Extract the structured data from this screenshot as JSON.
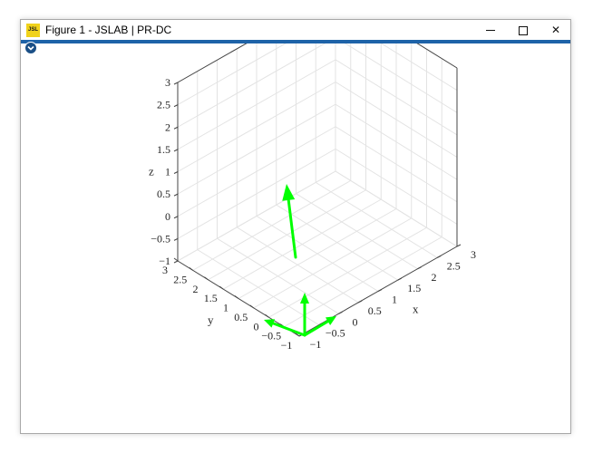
{
  "window": {
    "title": "Figure 1 - JSLAB | PR-DC",
    "app_icon_text": "JSL",
    "accent_color": "#1e63a8"
  },
  "controls": {
    "minimize_icon": "minimize-icon",
    "maximize_icon": "maximize-icon",
    "close_label": "✕"
  },
  "plot": {
    "arrow_color": "#00ff00",
    "axes": {
      "x": {
        "label": "x",
        "ticks": [
          "−1",
          "−0.5",
          "0",
          "0.5",
          "1",
          "1.5",
          "2",
          "2.5",
          "3"
        ]
      },
      "y": {
        "label": "y",
        "ticks": [
          "−1",
          "−0.5",
          "0",
          "0.5",
          "1",
          "1.5",
          "2",
          "2.5",
          "3"
        ]
      },
      "z": {
        "label": "z",
        "ticks": [
          "−1",
          "−0.5",
          "0",
          "0.5",
          "1",
          "1.5",
          "2",
          "2.5",
          "3"
        ]
      }
    }
  }
}
